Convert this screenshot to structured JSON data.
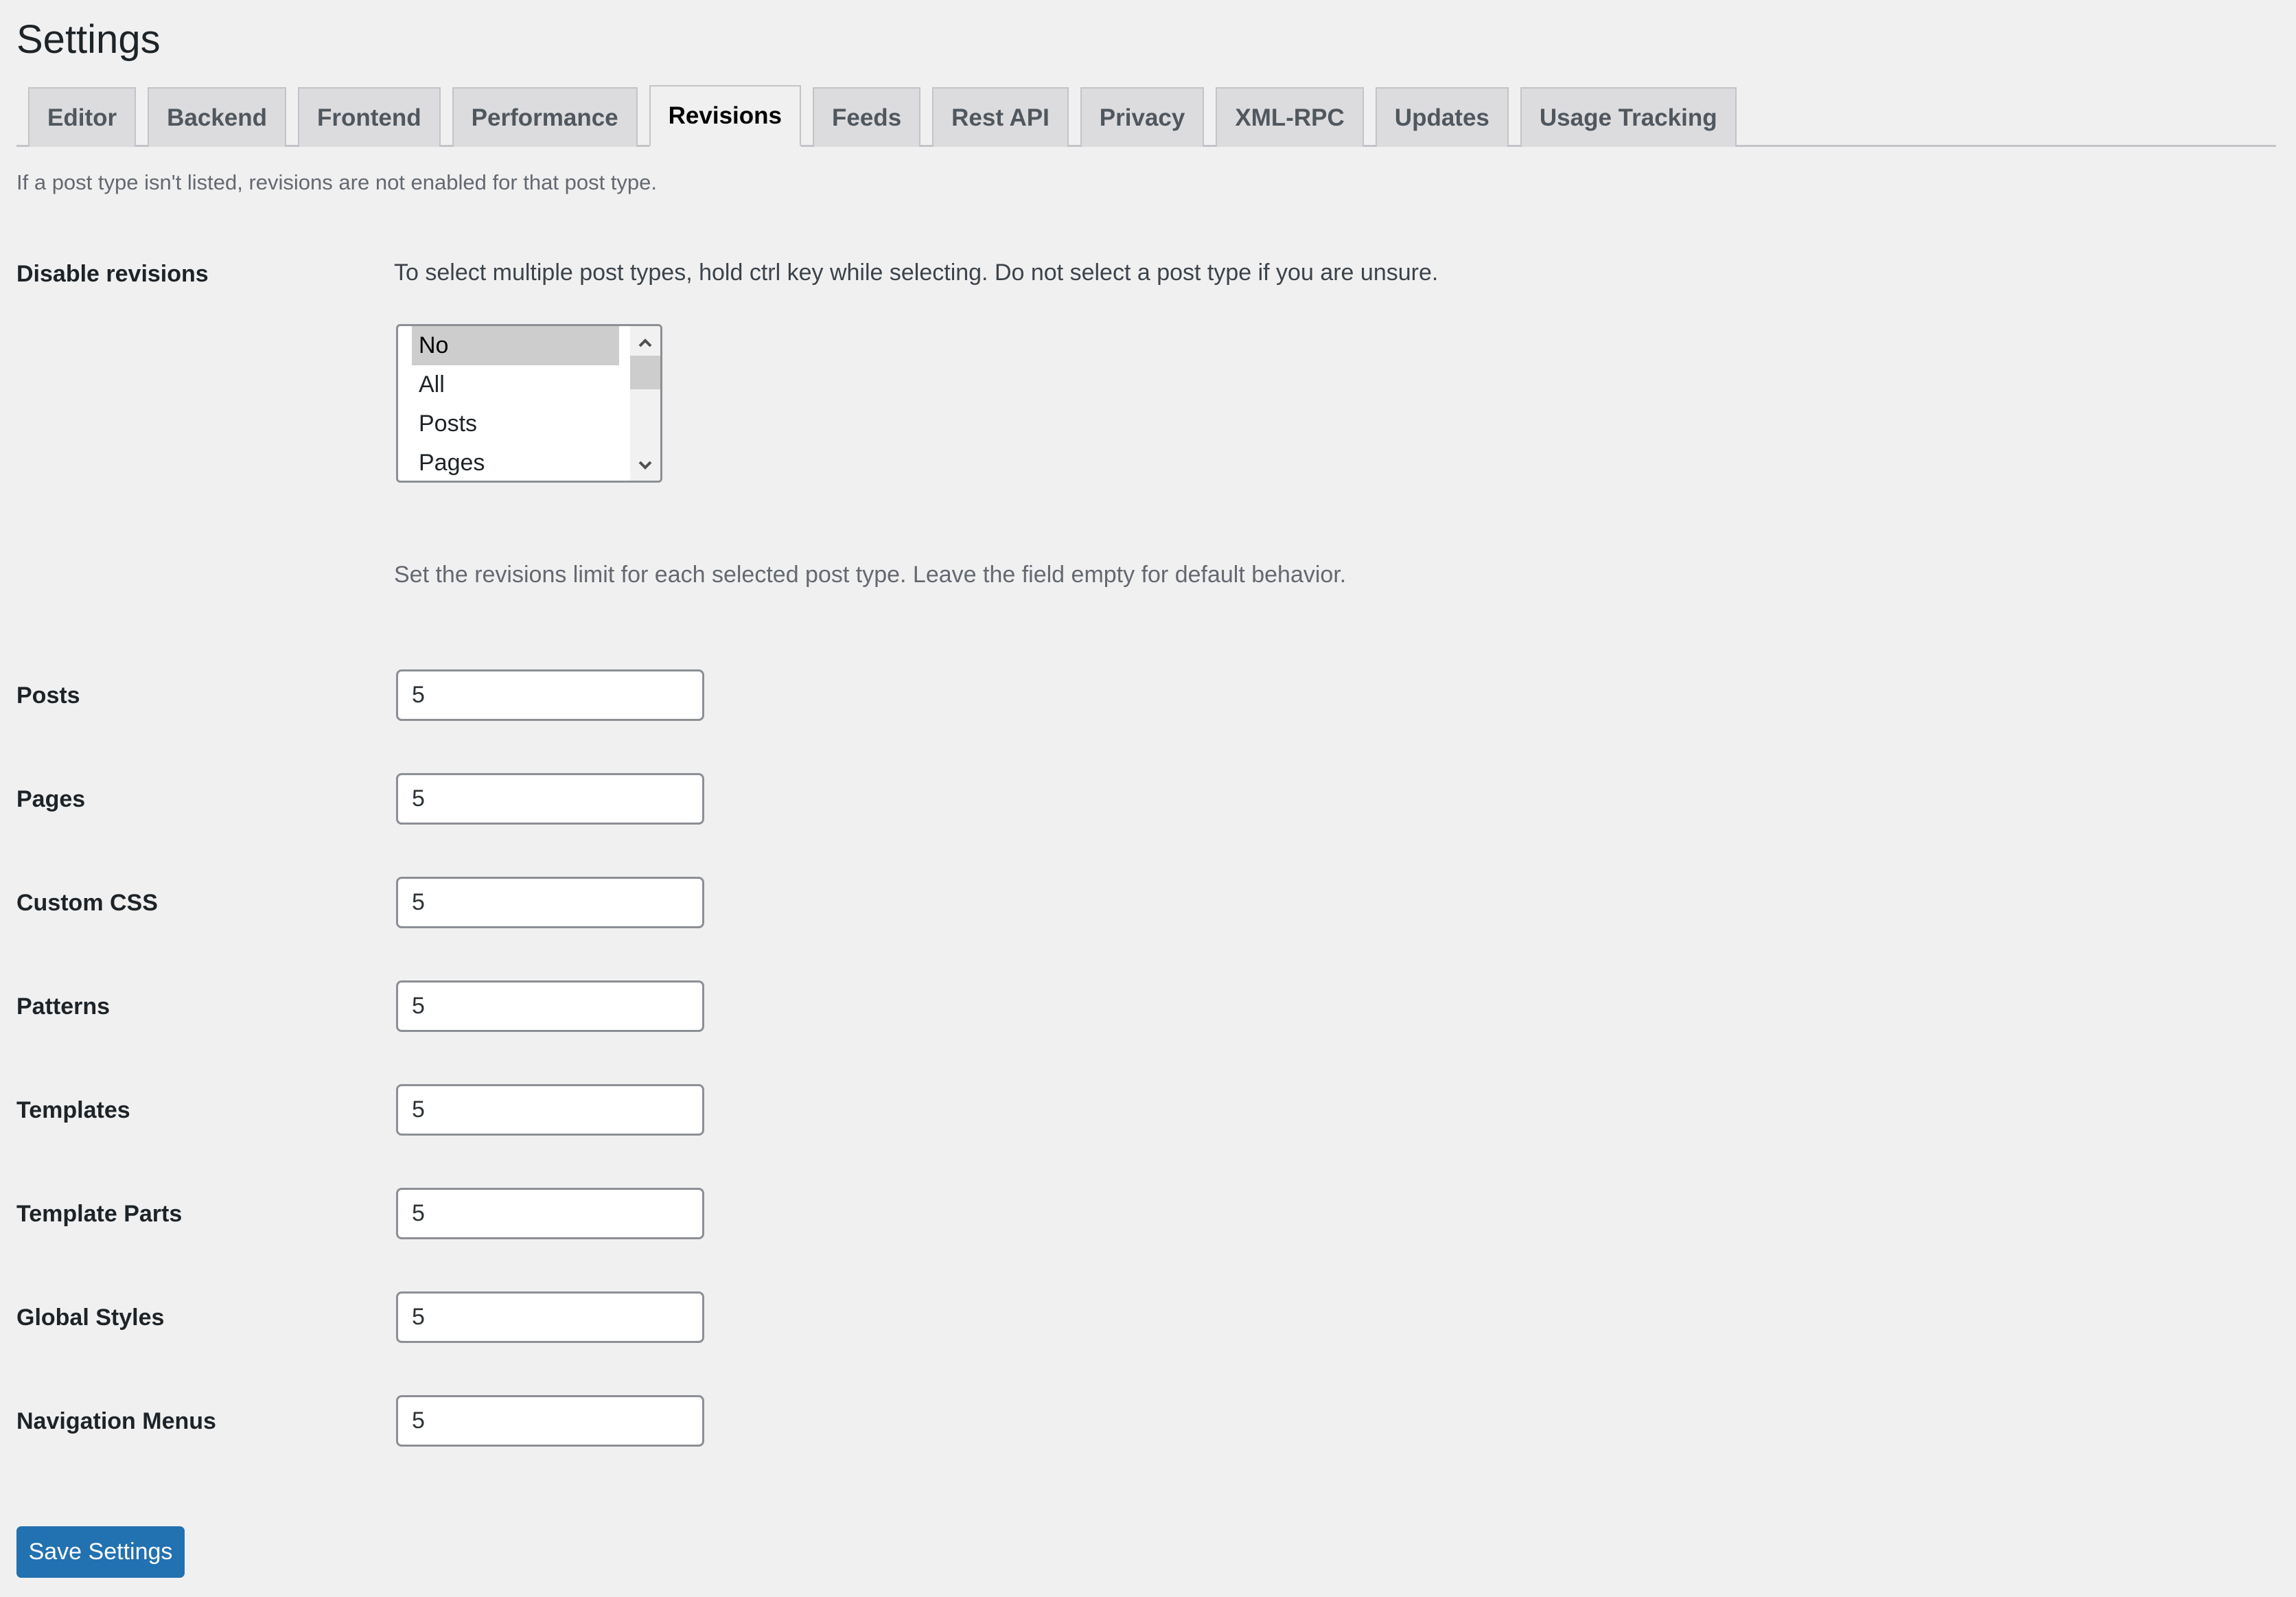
{
  "page": {
    "title": "Settings"
  },
  "tabs": [
    {
      "label": "Editor",
      "active": false
    },
    {
      "label": "Backend",
      "active": false
    },
    {
      "label": "Frontend",
      "active": false
    },
    {
      "label": "Performance",
      "active": false
    },
    {
      "label": "Revisions",
      "active": true
    },
    {
      "label": "Feeds",
      "active": false
    },
    {
      "label": "Rest API",
      "active": false
    },
    {
      "label": "Privacy",
      "active": false
    },
    {
      "label": "XML-RPC",
      "active": false
    },
    {
      "label": "Updates",
      "active": false
    },
    {
      "label": "Usage Tracking",
      "active": false
    }
  ],
  "notice": "If a post type isn't listed, revisions are not enabled for that post type.",
  "disable_revisions": {
    "label": "Disable revisions",
    "help": "To select multiple post types, hold ctrl key while selecting. Do not select a post type if you are unsure.",
    "options": [
      "No",
      "All",
      "Posts",
      "Pages"
    ],
    "selected": "No"
  },
  "limits_help": "Set the revisions limit for each selected post type. Leave the field empty for default behavior.",
  "limits": [
    {
      "label": "Posts",
      "value": "5"
    },
    {
      "label": "Pages",
      "value": "5"
    },
    {
      "label": "Custom CSS",
      "value": "5"
    },
    {
      "label": "Patterns",
      "value": "5"
    },
    {
      "label": "Templates",
      "value": "5"
    },
    {
      "label": "Template Parts",
      "value": "5"
    },
    {
      "label": "Global Styles",
      "value": "5"
    },
    {
      "label": "Navigation Menus",
      "value": "5"
    }
  ],
  "actions": {
    "save_label": "Save Settings"
  },
  "colors": {
    "primary": "#2271b1",
    "background": "#f0f0f1",
    "tab_inactive": "#dcdcde",
    "selected_option": "#cdcdcd"
  },
  "icons": {
    "scroll_up": "chevron-up-icon",
    "scroll_down": "chevron-down-icon"
  }
}
